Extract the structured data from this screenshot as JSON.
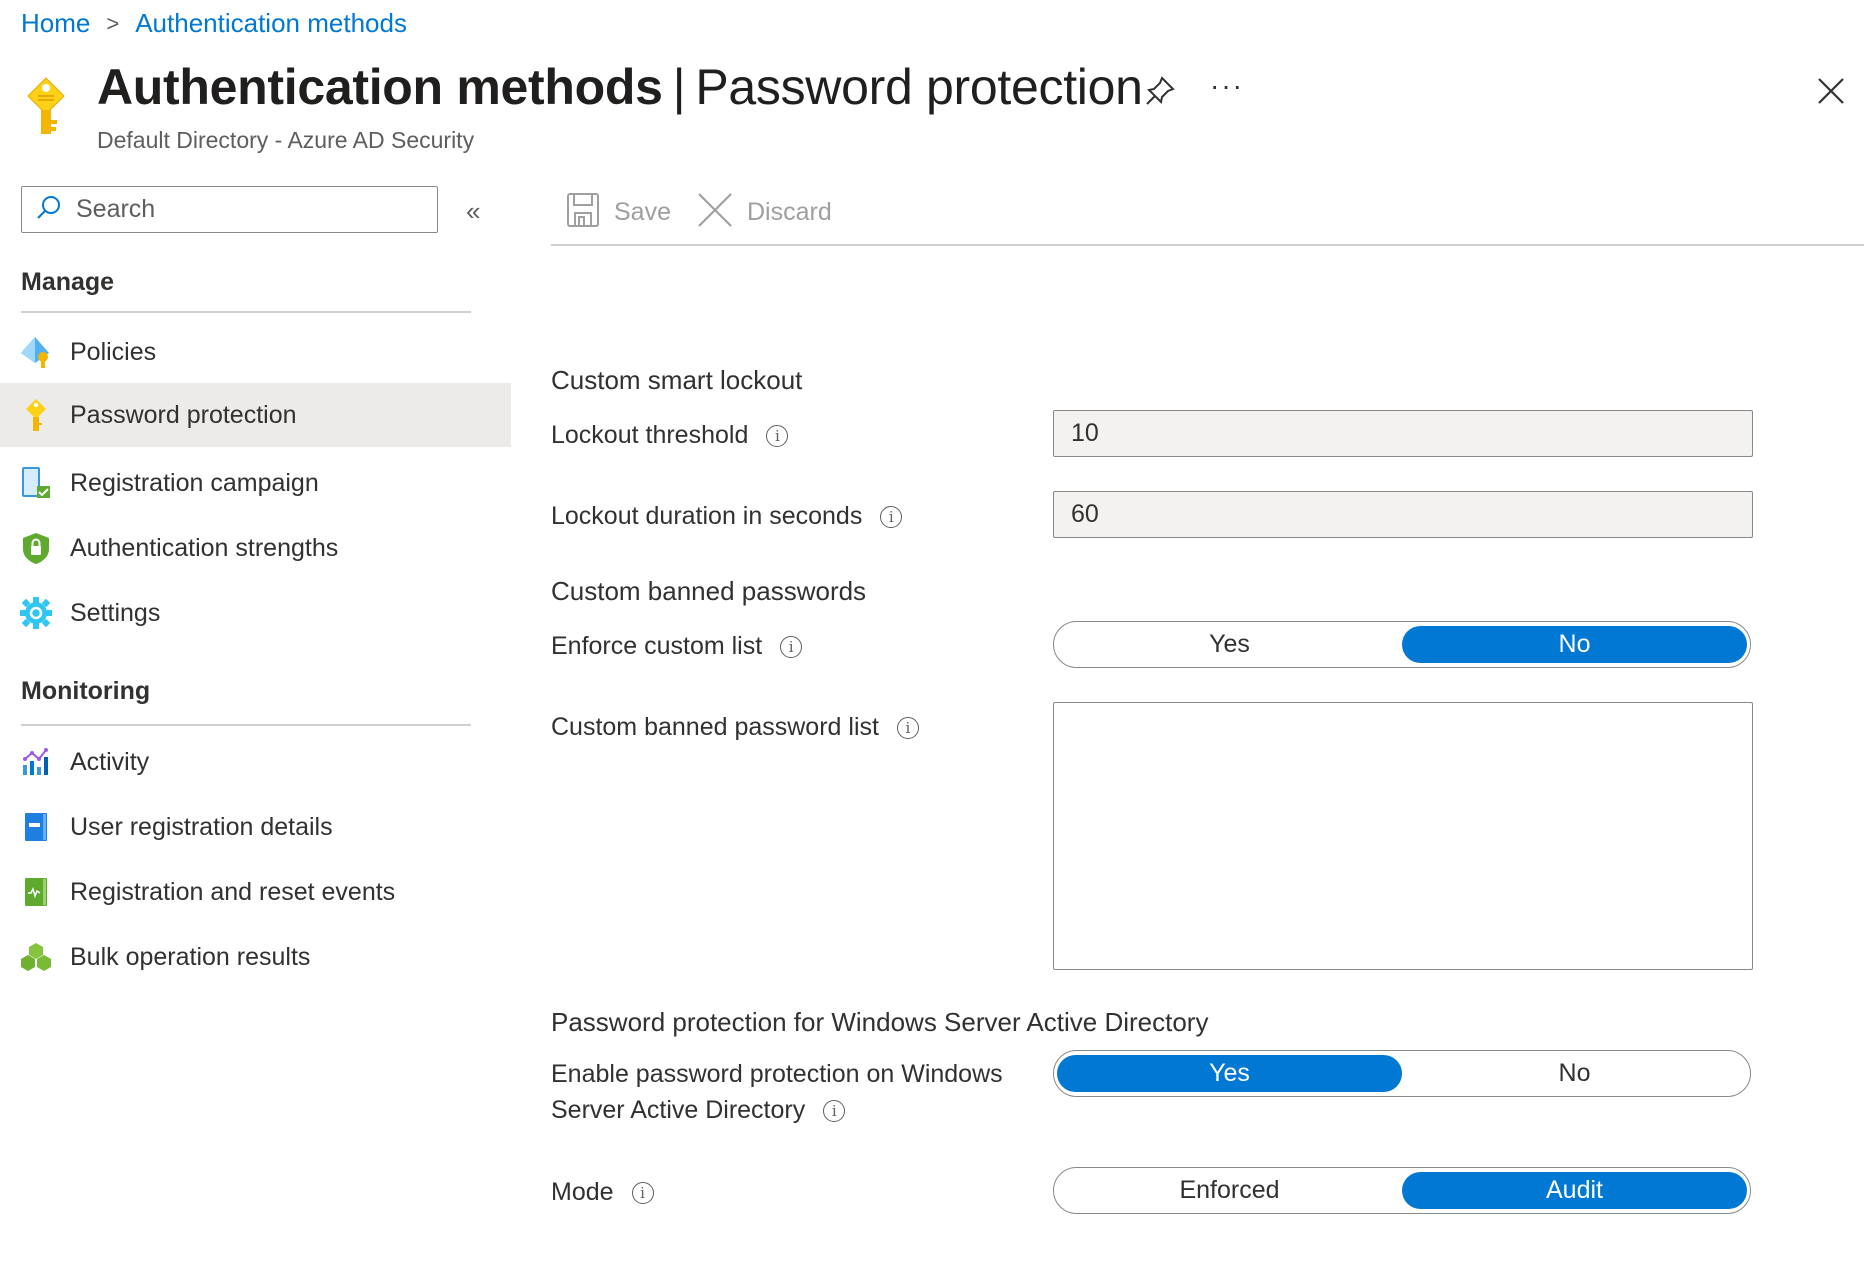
{
  "breadcrumb": {
    "items": [
      "Home",
      "Authentication methods"
    ],
    "separator": ">"
  },
  "header": {
    "title_main": "Authentication methods",
    "title_sep": "|",
    "title_page": "Password protection",
    "subtitle": "Default Directory - Azure AD Security",
    "more_label": "···"
  },
  "search": {
    "placeholder": "Search",
    "value": ""
  },
  "collapse_label": "«",
  "sidebar": {
    "sections": [
      {
        "title": "Manage",
        "items": [
          {
            "label": "Policies",
            "icon": "policies-icon"
          },
          {
            "label": "Password protection",
            "icon": "key-icon",
            "active": true
          },
          {
            "label": "Registration campaign",
            "icon": "phone-check-icon"
          },
          {
            "label": "Authentication strengths",
            "icon": "shield-lock-icon"
          },
          {
            "label": "Settings",
            "icon": "gear-icon"
          }
        ]
      },
      {
        "title": "Monitoring",
        "items": [
          {
            "label": "Activity",
            "icon": "activity-chart-icon"
          },
          {
            "label": "User registration details",
            "icon": "blue-book-icon"
          },
          {
            "label": "Registration and reset events",
            "icon": "green-book-icon"
          },
          {
            "label": "Bulk operation results",
            "icon": "cubes-icon"
          }
        ]
      }
    ]
  },
  "toolbar": {
    "save_label": "Save",
    "discard_label": "Discard"
  },
  "form": {
    "smart_lockout": {
      "heading": "Custom smart lockout",
      "threshold_label": "Lockout threshold",
      "threshold_value": "10",
      "duration_label": "Lockout duration in seconds",
      "duration_value": "60"
    },
    "banned_passwords": {
      "heading": "Custom banned passwords",
      "enforce_label": "Enforce custom list",
      "enforce_options": [
        "Yes",
        "No"
      ],
      "enforce_selected": "No",
      "list_label": "Custom banned password list",
      "list_value": ""
    },
    "windows_ad": {
      "heading": "Password protection for Windows Server Active Directory",
      "enable_label_line1": "Enable password protection on Windows",
      "enable_label_line2": "Server Active Directory",
      "enable_options": [
        "Yes",
        "No"
      ],
      "enable_selected": "Yes",
      "mode_label": "Mode",
      "mode_options": [
        "Enforced",
        "Audit"
      ],
      "mode_selected": "Audit"
    },
    "info_glyph": "i"
  },
  "colors": {
    "accent": "#0078d4",
    "active_nav_bg": "#edebe9",
    "disabled_text": "#a19f9d",
    "input_bg": "#f3f2f1"
  }
}
